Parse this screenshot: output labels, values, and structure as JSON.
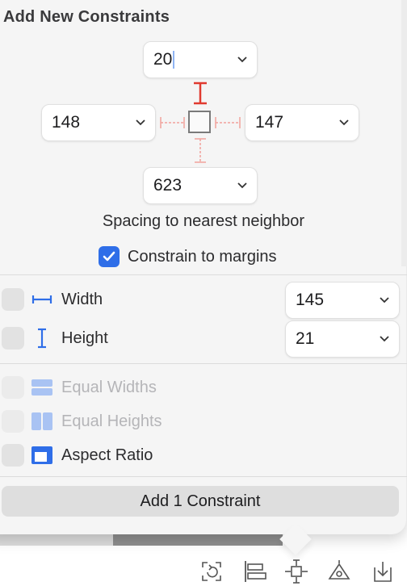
{
  "popover": {
    "title": "Add New Constraints",
    "spacing": {
      "top": "20",
      "left": "148",
      "right": "147",
      "bottom": "623",
      "caption": "Spacing to nearest neighbor"
    },
    "constrain_to_margins": {
      "label": "Constrain to margins",
      "checked": true
    },
    "size": {
      "width": {
        "label": "Width",
        "value": "145",
        "checked": false
      },
      "height": {
        "label": "Height",
        "value": "21",
        "checked": false
      }
    },
    "options": [
      {
        "label": "Equal Widths",
        "enabled": false
      },
      {
        "label": "Equal Heights",
        "enabled": false
      },
      {
        "label": "Aspect Ratio",
        "enabled": true
      }
    ],
    "add_button": "Add 1 Constraint"
  },
  "colors": {
    "accent": "#2f6ee8",
    "active_strut": "#e03a2f",
    "inactive_strut": "#f1a29c"
  },
  "toolbar": {
    "icons": [
      "update-frames-icon",
      "align-icon",
      "add-constraints-icon",
      "resolve-issues-icon",
      "embed-in-icon"
    ]
  }
}
